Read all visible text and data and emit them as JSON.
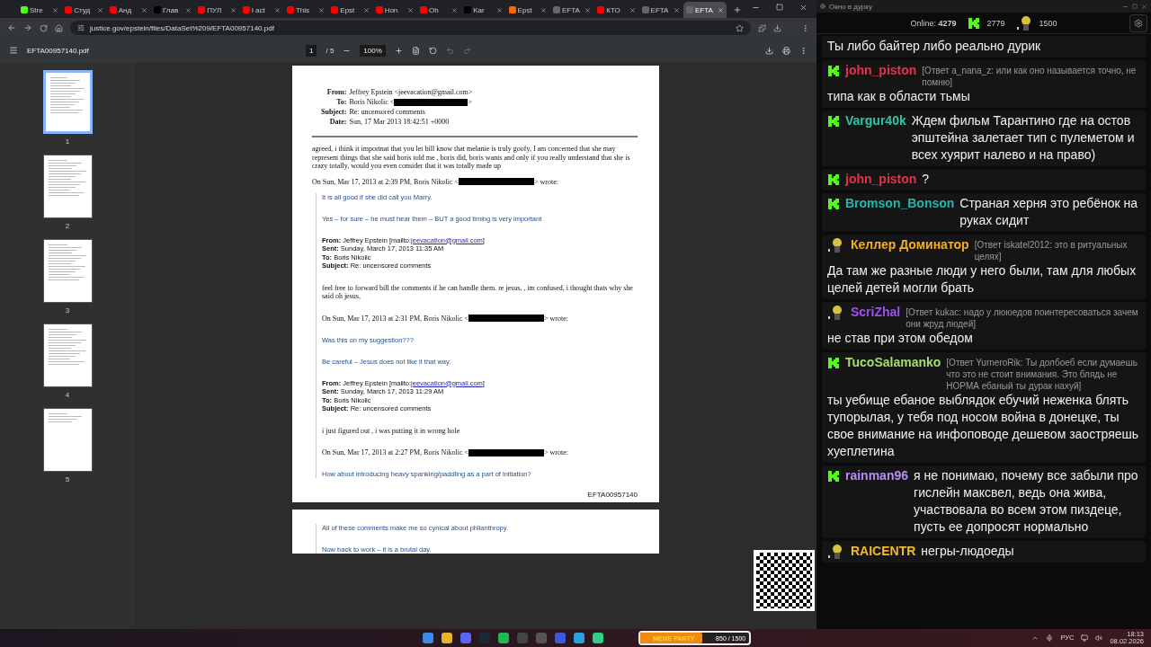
{
  "browser": {
    "tabs": [
      {
        "label": "Stre",
        "kind": "kick",
        "selected": false
      },
      {
        "label": "Студ",
        "kind": "youtube",
        "selected": false
      },
      {
        "label": "Анд",
        "kind": "youtube",
        "selected": false
      },
      {
        "label": "Глав",
        "kind": "x",
        "selected": false
      },
      {
        "label": "ПУЛ",
        "kind": "youtube",
        "selected": false
      },
      {
        "label": "I act",
        "kind": "youtube",
        "selected": false
      },
      {
        "label": "This",
        "kind": "youtube",
        "selected": false
      },
      {
        "label": "Epst",
        "kind": "youtube",
        "selected": false
      },
      {
        "label": "Hon",
        "kind": "youtube",
        "selected": false
      },
      {
        "label": "Oh",
        "kind": "youtube",
        "selected": false
      },
      {
        "label": "Kar",
        "kind": "x",
        "selected": false
      },
      {
        "label": "Epst",
        "kind": "orange",
        "selected": false
      },
      {
        "label": "EFTA",
        "kind": "web",
        "selected": false
      },
      {
        "label": "КТО",
        "kind": "youtube",
        "selected": false
      },
      {
        "label": "EFTA",
        "kind": "web",
        "selected": false
      },
      {
        "label": "EFTA",
        "kind": "web",
        "selected": true
      }
    ],
    "address": "justice.gov/epstein/files/DataSet%209/EFTA00957140.pdf",
    "pdf_toolbar": {
      "file_name": "EFTA00957140.pdf",
      "page": "1",
      "page_count": "/ 5",
      "zoom": "100%"
    },
    "thumbnails": [
      {
        "label": "1",
        "selected": true
      },
      {
        "label": "2",
        "selected": false
      },
      {
        "label": "3",
        "selected": false
      },
      {
        "label": "4",
        "selected": false
      },
      {
        "label": "5",
        "selected": false
      }
    ],
    "pages": [
      {
        "footer": "EFTA00957140",
        "blocks": [
          {
            "kind": "serif-header",
            "rows": [
              {
                "label": "From:",
                "text": "Jeffrey Epstein <jeevacation@gmail.com>",
                "redacted": false
              },
              {
                "label": "To:",
                "text": "Boris Nikolic <",
                "redacted": true,
                "tail": ">"
              },
              {
                "label": "Subject:",
                "text": "Re: uncensored comments",
                "redacted": false
              },
              {
                "label": "Date:",
                "text": "Sun, 17 Mar 2013 18:42:51 +0000",
                "redacted": false
              }
            ]
          },
          {
            "kind": "rule"
          },
          {
            "kind": "serif",
            "text": "agreed,  i think it importnat that you let bill know that melanie is truly goofy,  I am concerned that she may represent things that she said boris told me , boris did, boris wants and only if you really understand that she is crazy totally, would you even consider that it was totally made up"
          },
          {
            "kind": "wrote",
            "text": "On Sun, Mar 17, 2013 at 2:39 PM, Boris Nikolic <",
            "tail": "> wrote:"
          },
          {
            "kind": "quote",
            "blocks": [
              {
                "kind": "blue",
                "text": "It is all good if she did call you Marry."
              },
              {
                "kind": "blue",
                "text": "Yes – for sure – he must hear them – BUT a good timing is very important"
              },
              {
                "kind": "sans-header",
                "rows": [
                  {
                    "label": "From:",
                    "text": "Jeffrey Epstein [mailto:",
                    "link": "jeevacation@gmail.com",
                    "tail": "]"
                  },
                  {
                    "label": "Sent:",
                    "text": "Sunday, March 17, 2013 11:35 AM"
                  },
                  {
                    "label": "To:",
                    "text": "Boris Nikolic"
                  },
                  {
                    "label": "Subject:",
                    "text": "Re: uncensored comments"
                  }
                ]
              },
              {
                "kind": "serif",
                "text": "feel free to forward bill the comments  if he can handle them.   re jesus,  ,  im confused, i thought thats why she said oh jesus,"
              },
              {
                "kind": "wrote",
                "text": "On Sun, Mar 17, 2013 at 2:31 PM, Boris Nikolic <",
                "tail": "> wrote:"
              },
              {
                "kind": "blue",
                "text": "Was this on my suggestion???"
              },
              {
                "kind": "blue",
                "text": "Be careful – Jesus does not like it that way."
              },
              {
                "kind": "sans-header",
                "rows": [
                  {
                    "label": "From:",
                    "text": "Jeffrey Epstein [mailto:",
                    "link": "jeevacation@gmail.com",
                    "tail": "]"
                  },
                  {
                    "label": "Sent:",
                    "text": "Sunday, March 17, 2013 11:29 AM"
                  },
                  {
                    "label": "To:",
                    "text": "Boris Nikolic"
                  },
                  {
                    "label": "Subject:",
                    "text": "Re: uncensored comments"
                  }
                ]
              },
              {
                "kind": "serif",
                "text": "i just figured out , i was putting it in wrong hole"
              },
              {
                "kind": "wrote",
                "text": "On Sun, Mar 17, 2013 at 2:27 PM, Boris Nikolic <",
                "tail": "> wrote:"
              },
              {
                "kind": "blue",
                "text": "How about introducing heavy spanking/paddling as a part of initiation?"
              }
            ]
          }
        ]
      },
      {
        "blocks": [
          {
            "kind": "quote",
            "blocks": [
              {
                "kind": "blue",
                "text": "All of these comments make me so cynical about philanthropy."
              },
              {
                "kind": "blue",
                "text": "Now back to work – it is a brutal day."
              }
            ]
          }
        ]
      }
    ]
  },
  "chat": {
    "title": "Окно в дурку",
    "online_label": "Online:",
    "online": "4279",
    "kick_count": "2779",
    "avatar_count": "1500",
    "messages": [
      {
        "kind": "plain",
        "text": "Ты либо байтер либо реально дурик"
      },
      {
        "kind": "kick",
        "user": "john_piston",
        "color": "#e8304f",
        "reply": "[Ответ a_nana_z: или как оно называется точно, не помню]",
        "text": "типа как в области тьмы"
      },
      {
        "kind": "kick",
        "user": "Vargur40k",
        "color": "#2ec4a5",
        "text": "Ждем фильм Тарантино где на остов эпштейна залетает тип с пулеметом и всех хуярит налево и на право)"
      },
      {
        "kind": "kick",
        "user": "john_piston",
        "color": "#e8304f",
        "text": "?"
      },
      {
        "kind": "kick",
        "user": "Bromson_Bonson",
        "color": "#22b8ab",
        "text": "Страная херня это ребёнок на руках сидит"
      },
      {
        "kind": "avatar",
        "user": "Келлер Доминатор",
        "color": "#f2b01e",
        "reply": "[Ответ iskatel2012: это в ритуальных целях]",
        "text": "Да там же разные люди у него были, там для любых целей детей могли брать"
      },
      {
        "kind": "avatar",
        "user": "ScriZhal",
        "color": "#a050f0",
        "reply": "[Ответ kukac: надо у лююедов поинтересоваться зачем они жруд людей]",
        "text": "не став при этом обедом"
      },
      {
        "kind": "kick",
        "user": "TucoSalamanko",
        "color": "#9fe070",
        "reply": "[Ответ YurneroRik: Ты долбоеб если думаешь что это не стоит внимания. Это блядь не НОРМА ебаный ты дурак нахуй]",
        "text": "ты уебище ебаное выблядок ебучий неженка блять тупорылая, у тебя под носом война в донецке, ты свое внимание на инфоповоде дешевом заостряешь хуеплетина"
      },
      {
        "kind": "kick",
        "user": "rainman96",
        "color": "#b98cf5",
        "text": "я не понимаю, почему все забыли про гислейн максвел, ведь она жива, участвовала во всем этом пиздеце, пусть ее допросят нормально"
      },
      {
        "kind": "avatar",
        "user": "RAICENTR",
        "color": "#f5b928",
        "text": "негры-людоеды"
      }
    ]
  },
  "meme_party": {
    "title": "MEME PARTY",
    "progress": "850 / 1500",
    "level": 0.57
  },
  "taskbar": {
    "language": "РУС",
    "time": "18:13",
    "date": "08.02.2026"
  }
}
